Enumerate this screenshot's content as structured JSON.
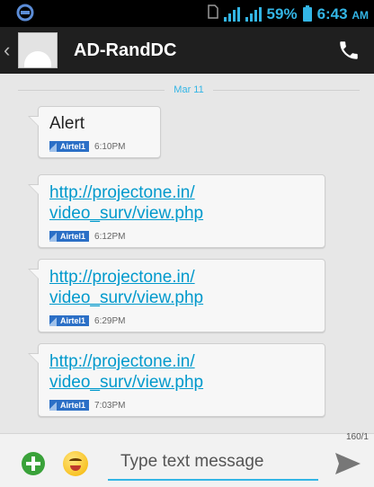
{
  "status_bar": {
    "battery": "59%",
    "time": "6:43",
    "ampm": "AM"
  },
  "header": {
    "contact_name": "AD-RandDC"
  },
  "thread": {
    "date": "Mar 11",
    "messages": [
      {
        "text": "Alert",
        "sim": "Airtel1",
        "time": "6:10PM"
      },
      {
        "text": "http://projectone.in/video_surv/view.php",
        "line1": "http://projectone.in/",
        "line2": "video_surv/view.php",
        "sim": "Airtel1",
        "time": "6:12PM"
      },
      {
        "text": "http://projectone.in/video_surv/view.php",
        "line1": "http://projectone.in/",
        "line2": "video_surv/view.php",
        "sim": "Airtel1",
        "time": "6:29PM"
      },
      {
        "text": "http://projectone.in/video_surv/view.php",
        "line1": "http://projectone.in/",
        "line2": "video_surv/view.php",
        "sim": "Airtel1",
        "time": "7:03PM"
      }
    ]
  },
  "composer": {
    "counter": "160/1",
    "placeholder": "Type text message",
    "value": ""
  },
  "colors": {
    "accent": "#33b5e5",
    "link": "#0099cc",
    "action_bar": "#1f1f1f",
    "sim_badge": "#2b6fc6"
  },
  "icons": [
    "app-notification-icon",
    "sim-icon",
    "signal-icon",
    "battery-icon",
    "back-icon",
    "contact-avatar-icon",
    "call-icon",
    "attach-icon",
    "emoji-icon",
    "send-icon"
  ]
}
